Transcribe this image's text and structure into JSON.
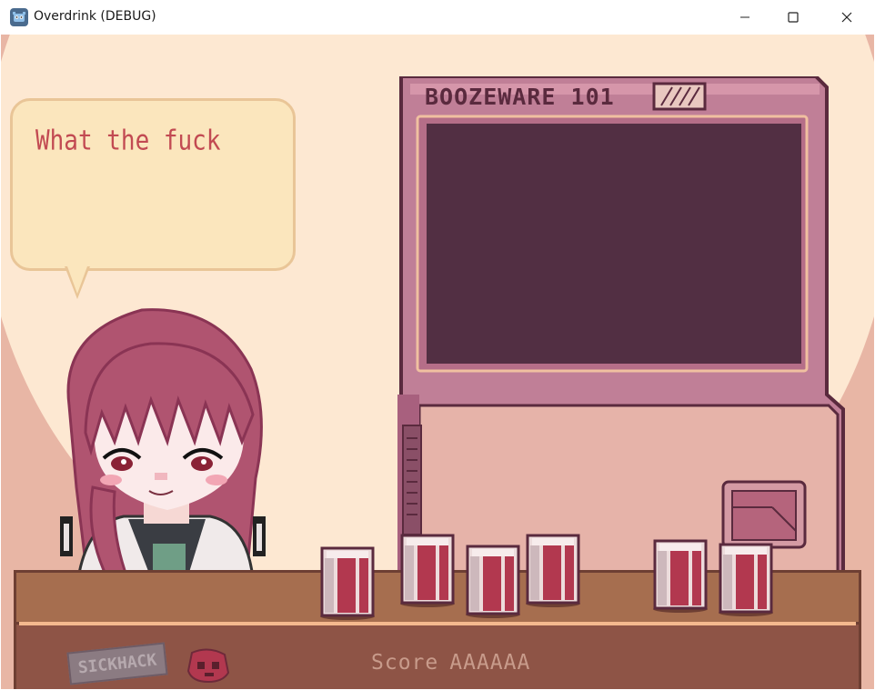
{
  "window": {
    "title": "Overdrink (DEBUG)",
    "app_icon": "godot-icon",
    "controls": {
      "minimize": "—",
      "maximize": "☐",
      "close": "✕"
    }
  },
  "dialogue": {
    "text": "What the fuck"
  },
  "machine": {
    "label": "BOOZEWARE 101"
  },
  "hud": {
    "sponsor_logo": "SICKHACK",
    "score_label": "Score",
    "score_value": "AAAAAA"
  },
  "colors": {
    "background": "#e8b6a5",
    "halo": "#fde8d2",
    "bubble": "#fbe6bd",
    "bubble_text": "#c24a52",
    "machine_body": "#c07f97",
    "machine_screen": "#522f43",
    "counter": "#a66e4f",
    "can_red": "#b2384f"
  },
  "cans": [
    {
      "name": "can-1"
    },
    {
      "name": "can-2"
    },
    {
      "name": "can-3"
    },
    {
      "name": "can-4"
    },
    {
      "name": "can-5"
    },
    {
      "name": "can-6"
    }
  ]
}
